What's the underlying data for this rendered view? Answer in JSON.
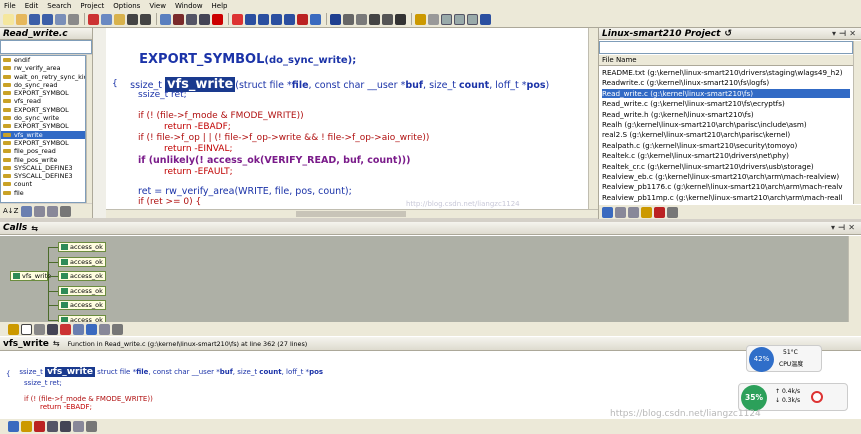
{
  "menu": [
    "File",
    "Edit",
    "Search",
    "Project",
    "Options",
    "View",
    "Window",
    "Help"
  ],
  "symbol_panel": {
    "title": "Read_write.c",
    "items": [
      "endif",
      "rw_verify_area",
      "wait_on_retry_sync_kiocb",
      "do_sync_read",
      "EXPORT_SYMBOL",
      "vfs_read",
      "EXPORT_SYMBOL",
      "do_sync_write",
      "EXPORT_SYMBOL",
      "vfs_write",
      "EXPORT_SYMBOL",
      "file_pos_read",
      "file_pos_write",
      "SYSCALL_DEFINE3",
      "SYSCALL_DEFINE3",
      "count",
      "file"
    ]
  },
  "editor": {
    "line1": {
      "a": "EXPORT_SYMBOL",
      "b": "(do_sync_write);"
    },
    "sig": {
      "a": "ssize_t ",
      "b": "vfs_write",
      "c": "(struct file *",
      "d": "file",
      ",": ", const char __user *",
      "e": "buf",
      ",2": ", size_t ",
      "f": "count",
      ",3": ", loff_t *",
      "g": "pos",
      ")": ")"
    },
    "lines": [
      "{",
      "ssize_t ret;",
      "",
      "if (! (file->f_mode & FMODE_WRITE))",
      "return -EBADF;",
      "if (! file->f_op | | (! file->f_op->write && ! file->f_op->aio_write))",
      "return -EINVAL;",
      "if (unlikely(! access_ok(VERIFY_READ, buf, count)))",
      "return -EFAULT;",
      "",
      "ret = rw_verify_area(WRITE, file, pos, count);",
      "if (ret >= 0) {"
    ],
    "watermark": "http://blog.csdn.net/liangzc1124"
  },
  "project": {
    "title": "Linux-smart210 Project",
    "column": "File Name",
    "files": [
      "README.txt (g:\\kernel\\linux-smart210\\drivers\\staging\\wlags49_h2)",
      "Readwrite.c (g:\\kernel\\linux-smart210\\fs\\logfs)",
      "Read_write.c (g:\\kernel\\linux-smart210\\fs)",
      "Read_write.c (g:\\kernel\\linux-smart210\\fs\\ecryptfs)",
      "Read_write.h (g:\\kernel\\linux-smart210\\fs)",
      "Realh (g:\\kernel\\linux-smart210\\arch\\parisc\\include\\asm)",
      "real2.S (g:\\kernel\\linux-smart210\\arch\\parisc\\kernel)",
      "Realpath.c (g:\\kernel\\linux-smart210\\security\\tomoyo)",
      "Realtek.c (g:\\kernel\\linux-smart210\\drivers\\net\\phy)",
      "Realtek_cr.c (g:\\kernel\\linux-smart210\\drivers\\usb\\storage)",
      "Realview_eb.c (g:\\kernel\\linux-smart210\\arch\\arm\\mach-realview)",
      "Realview_pb1176.c (g:\\kernel\\linux-smart210\\arch\\arm\\mach-realv",
      "Realview_pb11mp.c (g:\\kernel\\linux-smart210\\arch\\arm\\mach-reall"
    ]
  },
  "calls": {
    "title": "Calls",
    "root": "vfs_write",
    "children": [
      "access_ok",
      "access_ok",
      "access_ok",
      "access_ok",
      "access_ok",
      "access_ok"
    ]
  },
  "context": {
    "symbol": "vfs_write",
    "info": "Function in Read_write.c (g:\\kernel\\linux-smart210\\fs) at line 362 (27 lines)",
    "sig_a": "ssize_t ",
    "sig_b": "vfs_write",
    "sig_c": " struct file *",
    "sig_d": "file",
    "sig_e": ", const char __user *",
    "sig_f": "buf",
    "sig_g": ", size_t ",
    "sig_h": "count",
    "sig_i": ", loff_t *",
    "sig_j": "pos",
    "l1": "{",
    "l2": "ssize_t ret;",
    "l3": "if (! (file->f_mode & FMODE_WRITE))",
    "l4": "return -EBADF;"
  },
  "widget": {
    "percent": "42%",
    "cpu_temp": "51°C",
    "cpu_label": "CPU温度",
    "mem_percent": "35%",
    "up": "0.4k/s",
    "down": "0.3k/s",
    "watermark": "https://blog.csdn.net/liangzc1124"
  }
}
